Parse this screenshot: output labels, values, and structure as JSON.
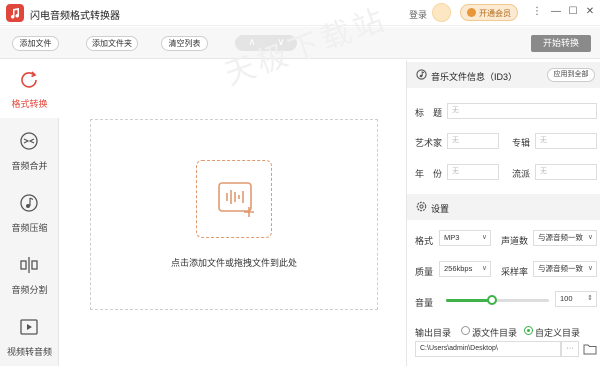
{
  "app": {
    "title": "闪电音频格式转换器",
    "accent": "#e0463a"
  },
  "titlebar": {
    "login": "登录",
    "vip": "开通会员",
    "menu": "⋮",
    "minimize": "—",
    "maximize": "☐",
    "close": "✕"
  },
  "toolbar": {
    "add_file": "添加文件",
    "add_folder": "添加文件夹",
    "clear_list": "清空列表",
    "up": "∧",
    "down": "∨",
    "start": "开始转换"
  },
  "sidebar": {
    "items": [
      {
        "label": "格式转换",
        "icon": "convert-icon",
        "active": true
      },
      {
        "label": "音频合并",
        "icon": "merge-icon",
        "active": false
      },
      {
        "label": "音频压缩",
        "icon": "compress-icon",
        "active": false
      },
      {
        "label": "音频分割",
        "icon": "split-icon",
        "active": false
      },
      {
        "label": "视频转音频",
        "icon": "video-icon",
        "active": false
      }
    ]
  },
  "drop": {
    "hint": "点击添加文件或拖拽文件到此处"
  },
  "watermark": "天极下载站",
  "id3": {
    "title": "音乐文件信息（ID3）",
    "apply_all": "应用到全部",
    "fields": {
      "title_label": "标　题",
      "artist_label": "艺术家",
      "album_label": "专辑",
      "year_label": "年　份",
      "genre_label": "流派",
      "placeholder": "无"
    }
  },
  "settings": {
    "title": "设置",
    "format_label": "格式",
    "format_value": "MP3",
    "channels_label": "声道数",
    "channels_value": "与源音频一致",
    "quality_label": "质量",
    "quality_value": "256kbps",
    "samplerate_label": "采样率",
    "samplerate_value": "与源音频一致",
    "volume_label": "音量",
    "volume_value": "100",
    "volume_level": 0.45,
    "output_label": "输出目录",
    "opt_source": "源文件目录",
    "opt_custom": "自定义目录",
    "output_path": "C:\\Users\\admin\\Desktop\\",
    "more": "···"
  }
}
